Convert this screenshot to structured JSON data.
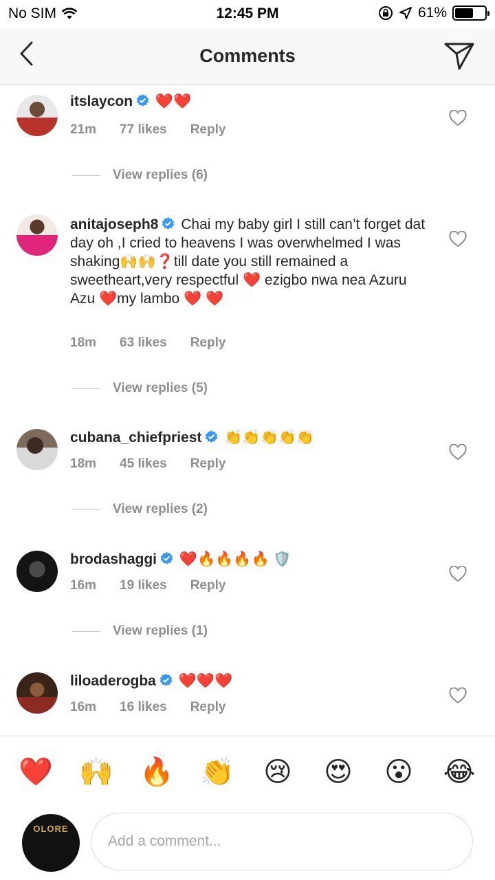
{
  "status": {
    "carrier": "No SIM",
    "time": "12:45 PM",
    "battery": "61%",
    "battery_level": 0.61
  },
  "header": {
    "title": "Comments"
  },
  "comments": [
    {
      "username": "itslaycon",
      "text": "❤️❤️",
      "time": "21m",
      "likes": "77 likes",
      "reply": "Reply",
      "view_replies": "View replies (6)"
    },
    {
      "username": "anitajoseph8",
      "text": "Chai my baby girl I still can’t forget dat day oh ,I cried to heavens I was overwhelmed I was shaking🙌🙌❓till date you still remained a sweetheart,very respectful ❤️ ezigbo nwa nea Azuru Azu ❤️my lambo ❤️ ❤️",
      "time": "18m",
      "likes": "63 likes",
      "reply": "Reply",
      "view_replies": "View replies (5)"
    },
    {
      "username": "cubana_chiefpriest",
      "text": "👏👏👏👏👏",
      "time": "18m",
      "likes": "45 likes",
      "reply": "Reply",
      "view_replies": "View replies (2)"
    },
    {
      "username": "brodashaggi",
      "text": "❤️🔥🔥🔥🔥 🛡️",
      "time": "16m",
      "likes": "19 likes",
      "reply": "Reply",
      "view_replies": "View replies (1)"
    },
    {
      "username": "liloaderogba",
      "text": "❤️❤️❤️",
      "time": "16m",
      "likes": "16 likes",
      "reply": "Reply"
    }
  ],
  "reactions": [
    "❤️",
    "🙌",
    "🔥",
    "👏",
    "😢",
    "😍",
    "😮",
    "😂"
  ],
  "composer": {
    "placeholder": "Add a comment...",
    "avatar_text": "OLORE"
  },
  "colors": {
    "verified": "#3897f0",
    "meta": "#8e8e8e",
    "text": "#262626"
  }
}
